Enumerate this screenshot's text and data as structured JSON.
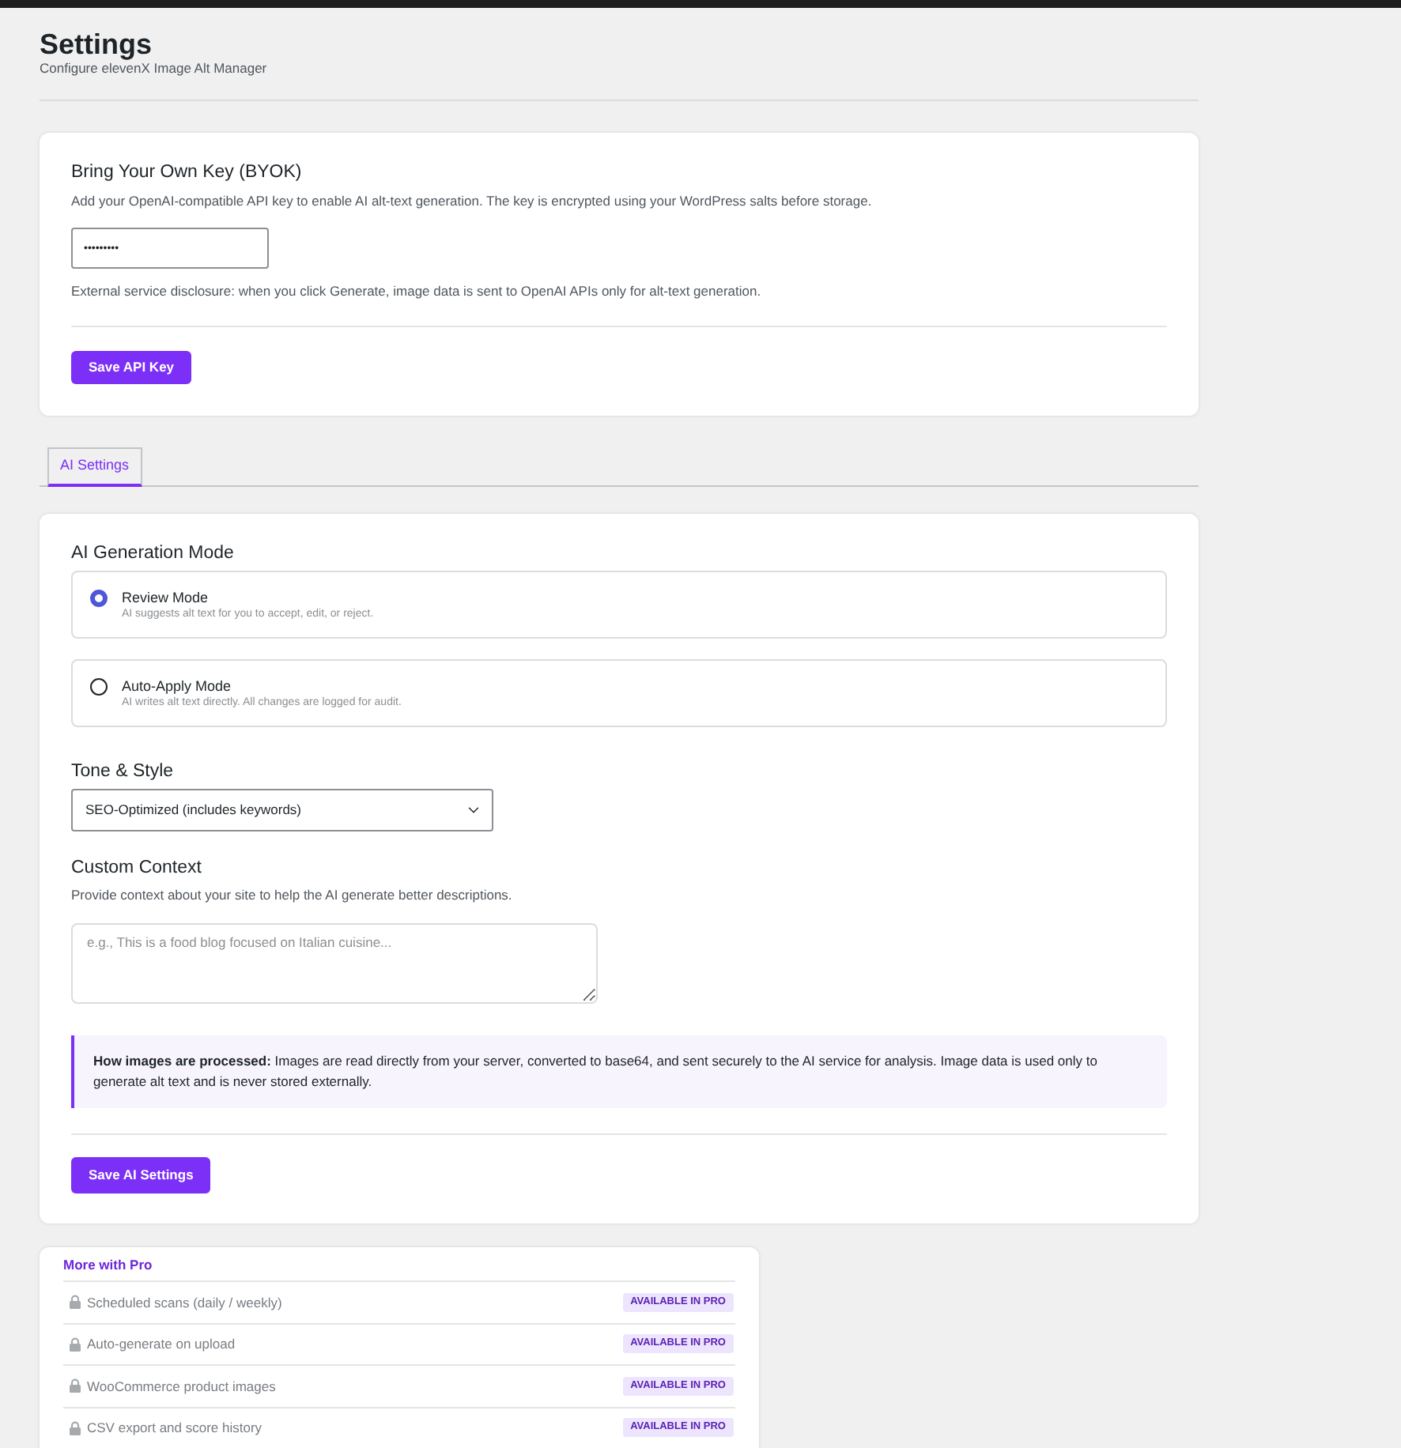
{
  "page": {
    "title": "Settings",
    "subtitle": "Configure elevenX Image Alt Manager"
  },
  "byok": {
    "heading": "Bring Your Own Key (BYOK)",
    "description": "Add your OpenAI-compatible API key to enable AI alt-text generation. The key is encrypted using your WordPress salts before storage.",
    "api_key_field": {
      "value": "•••••••••"
    },
    "disclosure": "External service disclosure: when you click Generate, image data is sent to OpenAI APIs only for alt-text generation.",
    "save_button": "Save API Key"
  },
  "tabs": [
    {
      "label": "AI Settings",
      "selected": true
    }
  ],
  "ai_settings": {
    "mode_heading": "AI Generation Mode",
    "modes": [
      {
        "title": "Review Mode",
        "description": "AI suggests alt text for you to accept, edit, or reject.",
        "selected": true
      },
      {
        "title": "Auto-Apply Mode",
        "description": "AI writes alt text directly. All changes are logged for audit.",
        "selected": false
      }
    ],
    "tone_label": "Tone & Style",
    "tone_select": {
      "value": "SEO-Optimized (includes keywords)"
    },
    "context_label": "Custom Context",
    "context_description": "Provide context about your site to help the AI generate better descriptions.",
    "context_field": {
      "placeholder": "e.g., This is a food blog focused on Italian cuisine..."
    },
    "info_note": "**How images are processed:** Images are read directly from your server, converted to base64, and sent securely to the AI service for analysis. Image data is used only to generate alt text and is never stored externally.",
    "save_button": "Save AI Settings"
  },
  "pro_features": {
    "heading": "More with Pro",
    "items": [
      {
        "label": "Scheduled scans (daily / weekly)",
        "badge": "AVAILABLE IN PRO"
      },
      {
        "label": "Auto-generate on upload",
        "badge": "AVAILABLE IN PRO"
      },
      {
        "label": "WooCommerce product images",
        "badge": "AVAILABLE IN PRO"
      },
      {
        "label": "CSV export and score history",
        "badge": "AVAILABLE IN PRO"
      }
    ]
  }
}
